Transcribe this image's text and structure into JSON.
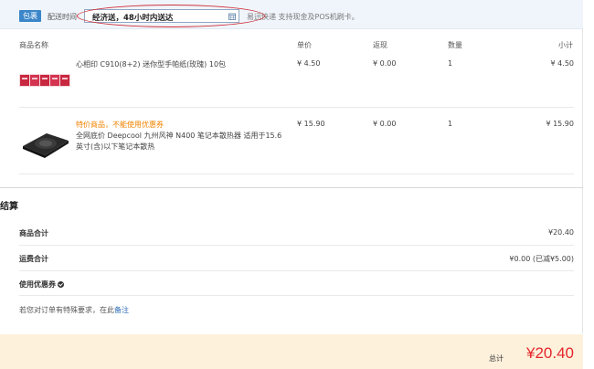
{
  "delivery": {
    "package_badge": "包裹",
    "time_label": "配送时间",
    "selected_option": "经济送，48小时内送达",
    "payment_note": "易迅快递 支持现金及POS机刷卡。"
  },
  "table": {
    "headers": {
      "name": "商品名称",
      "price": "单价",
      "refund": "返现",
      "quantity": "数量",
      "subtotal": "小计"
    },
    "rows": [
      {
        "name": "心相印 C910(8+2) 迷你型手帕纸(玫瑰) 10包",
        "special": "",
        "price": "¥ 4.50",
        "refund": "¥ 0.00",
        "quantity": "1",
        "subtotal": "¥ 4.50"
      },
      {
        "name_line1": "全网底价 Deepcool 九州风神 N400 笔记本散热器 适用于15.6",
        "name_line2": "英寸(含)以下笔记本散热",
        "special": "特价商品，不能使用优惠券",
        "price": "¥ 15.90",
        "refund": "¥ 0.00",
        "quantity": "1",
        "subtotal": "¥ 15.90"
      }
    ]
  },
  "settlement": {
    "title": "结算",
    "goods_total_label": "商品合计",
    "goods_total_value": "¥20.40",
    "shipping_label": "运费合计",
    "shipping_value": "¥0.00 (已减¥5.00)",
    "coupon_label": "使用优惠券",
    "note_text": "若您对订单有特殊要求，在此",
    "note_link": "备注"
  },
  "total": {
    "label": "总计",
    "amount": "¥20.40"
  },
  "colors": {
    "accent_blue": "#3b86c9",
    "price_red": "#e4262c",
    "special_orange": "#f08300",
    "total_bar_bg": "#fdf1dc"
  },
  "icons": [
    "calendar-icon",
    "check-circle-icon"
  ]
}
